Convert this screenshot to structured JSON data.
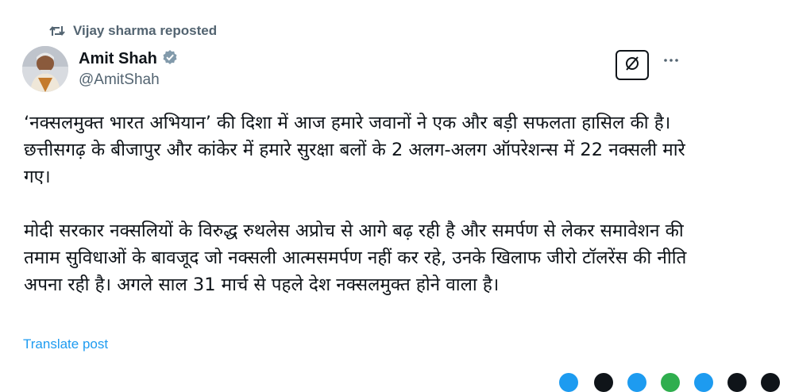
{
  "repost": {
    "icon": "repost-icon",
    "label": "Vijay sharma reposted"
  },
  "author": {
    "name": "Amit Shah",
    "handle": "@AmitShah",
    "verified_badge": "verified-badge-icon",
    "avatar": "avatar"
  },
  "actions": {
    "grok": "grok-icon",
    "more": "more-icon"
  },
  "post": {
    "paragraph1": "‘नक्सलमुक्त भारत अभियान’ की दिशा में आज हमारे जवानों ने एक और बड़ी सफलता हासिल की है। छत्तीसगढ़ के बीजापुर और कांकेर में हमारे सुरक्षा बलों के 2 अलग-अलग ऑपरेशन्स में 22 नक्सली मारे गए।",
    "paragraph2": "मोदी सरकार नक्सलियों के विरुद्ध रुथलेस अप्रोच से आगे बढ़ रही है और समर्पण से लेकर समावेशन की तमाम सुविधाओं के बावजूद जो नक्सली आत्मसमर्पण नहीं कर रहे, उनके खिलाफ जीरो टॉलरेंस की नीति अपना रही है। अगले साल 31 मार्च से पहले देश नक्सलमुक्त होने वाला है।"
  },
  "translate_label": "Translate post",
  "colors": {
    "text": "#0f1419",
    "secondary": "#536471",
    "link": "#1d9bf0",
    "verified_badge": "#829aab"
  }
}
